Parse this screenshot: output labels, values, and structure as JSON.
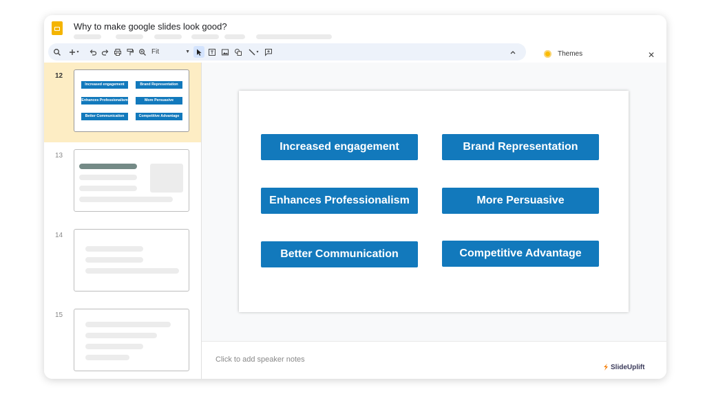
{
  "title": "Why to make google slides look good?",
  "toolbar": {
    "zoom_label": "Fit",
    "icons": [
      "search-icon",
      "add-icon",
      "undo-icon",
      "redo-icon",
      "print-icon",
      "paint-format-icon",
      "zoom-icon",
      "select-icon",
      "text-box-icon",
      "image-icon",
      "shape-icon",
      "line-icon",
      "comment-icon",
      "collapse-icon"
    ]
  },
  "themes_panel": {
    "label": "Themes"
  },
  "filmstrip": {
    "slides": [
      {
        "number": "12",
        "selected": true
      },
      {
        "number": "13"
      },
      {
        "number": "14"
      },
      {
        "number": "15"
      }
    ],
    "thumb_labels": [
      "Increased engagement",
      "Brand Representation",
      "Enhances Professionalism",
      "More Persuasive",
      "Better Communication",
      "Competitive Advantage"
    ]
  },
  "slide": {
    "items": [
      "Increased engagement",
      "Brand Representation",
      "Enhances Professionalism",
      "More Persuasive",
      "Better Communication",
      "Competitive Advantage"
    ]
  },
  "notes": {
    "placeholder": "Click to add speaker notes"
  },
  "branding": {
    "name": "SlideUplift"
  },
  "colors": {
    "accent": "#1279bc",
    "selected_slide_bg": "#fdedc4",
    "toolbar_bg": "#edf2fa",
    "app_icon": "#f4b400"
  }
}
